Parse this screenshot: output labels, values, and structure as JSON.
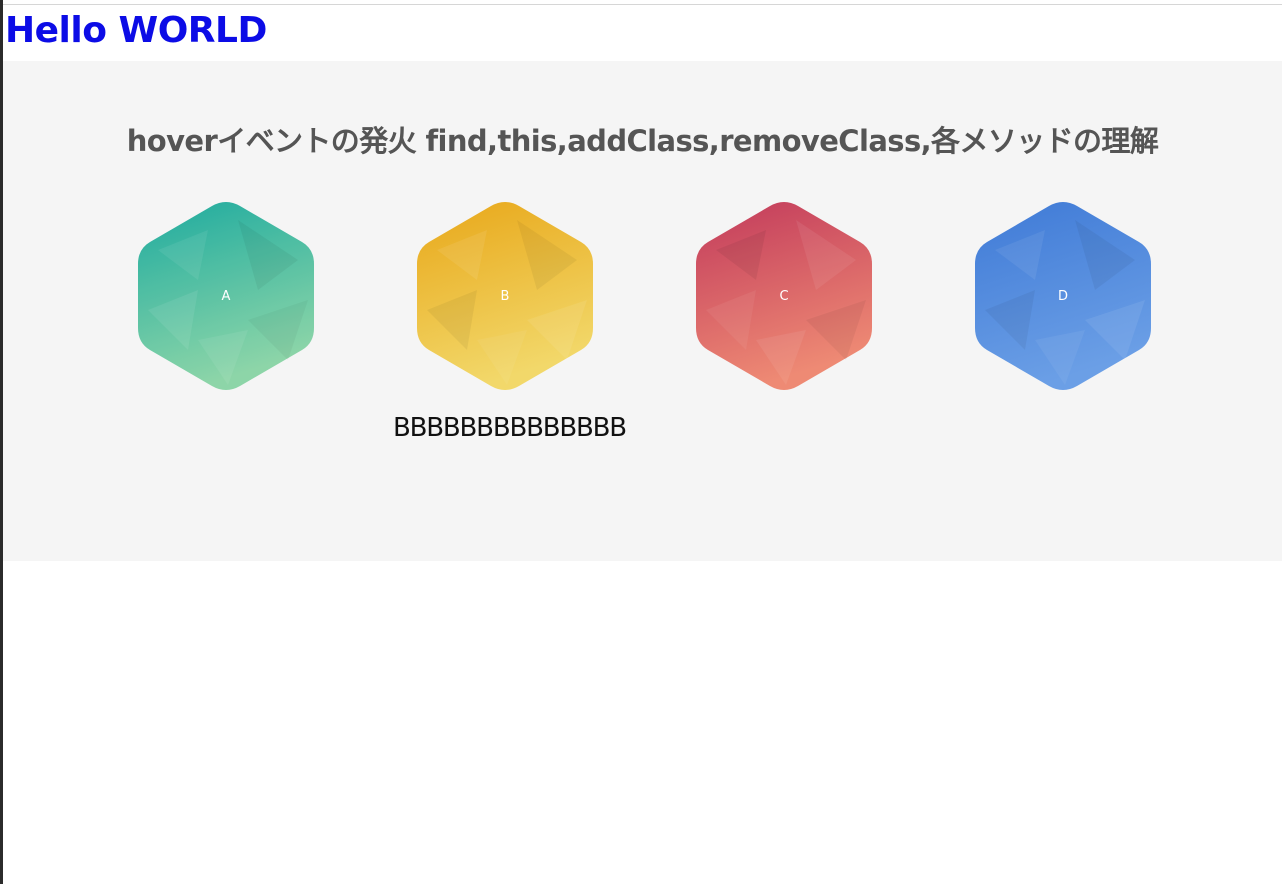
{
  "heading": "Hello WORLD",
  "section": {
    "title": "hoverイベントの発火 find,this,addClass,removeClass,各メソッドの理解",
    "hover_text": "BBBBBBBBBBBBBB",
    "items": [
      {
        "label": "A",
        "color_top": "#10a69a",
        "color_bottom": "#86d3a3",
        "icon": "hexagon-icon"
      },
      {
        "label": "B",
        "color_top": "#e8a719",
        "color_bottom": "#f2d86a",
        "icon": "hexagon-icon"
      },
      {
        "label": "C",
        "color_top": "#c23a5b",
        "color_bottom": "#ee8a74",
        "icon": "hexagon-icon"
      },
      {
        "label": "D",
        "color_top": "#3f7ad6",
        "color_bottom": "#6b9fe6",
        "icon": "hexagon-icon"
      }
    ]
  }
}
